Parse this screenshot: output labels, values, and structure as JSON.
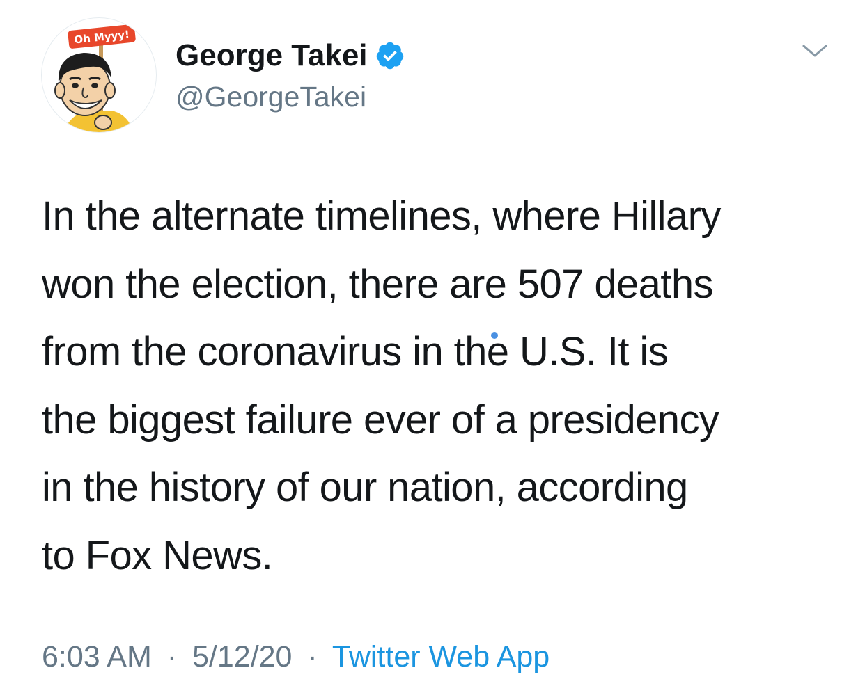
{
  "author": {
    "display_name": "George Takei",
    "handle": "@GeorgeTakei",
    "verified": true,
    "avatar": {
      "sign_text": "Oh Myyy!",
      "sign_color": "#e8472b"
    }
  },
  "tweet": {
    "lines": [
      "In the alternate timelines, where Hillary",
      "won the election, there are 507 deaths",
      "from the coronavirus in the U.S. It is",
      "the biggest failure ever of a presidency",
      "in the history of our nation, according",
      "to Fox News."
    ]
  },
  "meta": {
    "time": "6:03 AM",
    "separator": "·",
    "date": "5/12/20",
    "source": "Twitter Web App"
  },
  "icons": {
    "verified": "verified-badge-icon",
    "menu": "chevron-down-icon"
  },
  "colors": {
    "text": "#14171a",
    "secondary": "#657786",
    "link": "#1b95e0",
    "verified": "#1da1f2"
  }
}
